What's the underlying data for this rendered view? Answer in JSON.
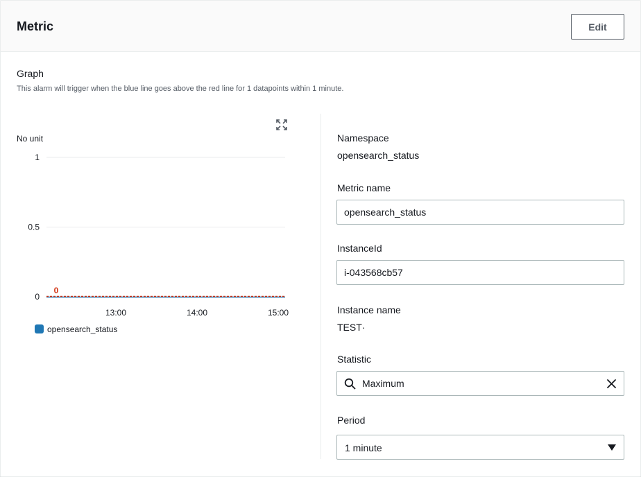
{
  "panel": {
    "title": "Metric",
    "edit_label": "Edit"
  },
  "graph": {
    "title": "Graph",
    "description": "This alarm will trigger when the blue line goes above the red line for 1 datapoints within 1 minute."
  },
  "chart_data": {
    "type": "line",
    "unit_label": "No unit",
    "x_ticks": [
      "13:00",
      "14:00",
      "15:00"
    ],
    "y_ticks": [
      "0",
      "0.5",
      "1"
    ],
    "ylim": [
      0,
      1
    ],
    "series": [
      {
        "name": "opensearch_status",
        "color": "#1f77b4",
        "values": [
          0,
          0,
          0,
          0
        ]
      }
    ],
    "threshold": {
      "value": 0,
      "label": "0",
      "color": "#d13212"
    },
    "legend_position": "bottom-left"
  },
  "fields": {
    "namespace_label": "Namespace",
    "namespace_value": "opensearch_status",
    "metric_name_label": "Metric name",
    "metric_name_value": "opensearch_status",
    "instance_id_label": "InstanceId",
    "instance_id_value": "i-043568cb57",
    "instance_name_label": "Instance name",
    "instance_name_value": "TEST·",
    "statistic_label": "Statistic",
    "statistic_value": "Maximum",
    "period_label": "Period",
    "period_value": "1 minute"
  },
  "icons": {
    "expand": "expand-icon",
    "search": "search-icon",
    "clear": "close-icon",
    "caret": "caret-down-icon"
  },
  "colors": {
    "accent_blue": "#1f77b4",
    "threshold_red": "#d13212",
    "border": "#aab7b8",
    "header_bg": "#fafafa"
  }
}
